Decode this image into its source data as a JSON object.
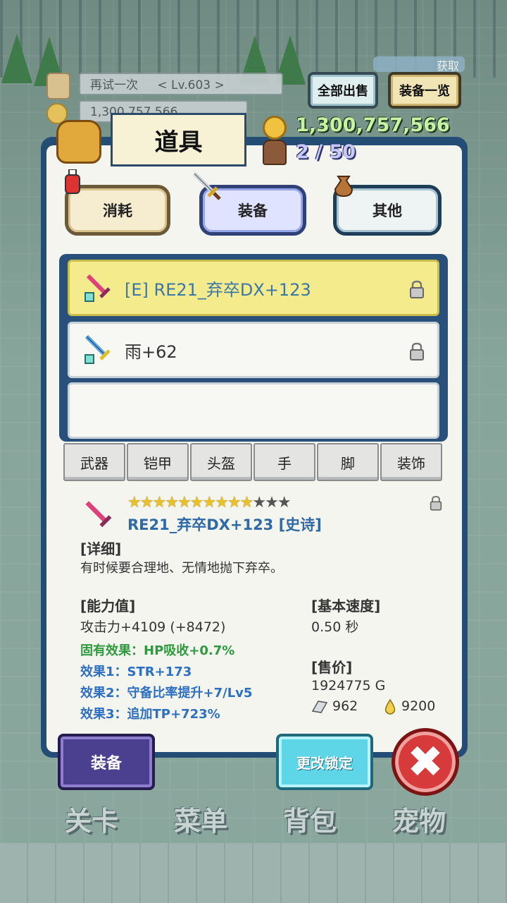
{
  "top": {
    "retry_label": "再试一次",
    "level": "< Lv.603 >",
    "gold_bg": "1,300,757,566",
    "sell_all_label": "全部出售",
    "equip_list_label": "装备一览",
    "gain_label": "获取"
  },
  "panel": {
    "title": "道具",
    "gold": "1,300,757,566",
    "capacity": "2 / 50"
  },
  "categories": {
    "consume": "消耗",
    "equip": "装备",
    "other": "其他"
  },
  "items": [
    {
      "label": "[E] RE21_弃卒DX+123",
      "locked": true
    },
    {
      "label": "雨+62",
      "locked": true
    },
    {
      "label": "",
      "locked": false
    }
  ],
  "slots": [
    "武器",
    "铠甲",
    "头盔",
    "手",
    "脚",
    "装饰"
  ],
  "detail": {
    "stars_filled": 10,
    "stars_total": 13,
    "name": "RE21_弃卒DX+123 [史诗]",
    "desc_head": "[详细]",
    "desc": "有时候要合理地、无情地抛下弃卒。",
    "stats_head": "[能力值]",
    "attack": "攻击力+4109 (+8472)",
    "inherent": "固有效果：HP吸收+0.7%",
    "effect1": "效果1：STR+173",
    "effect2": "效果2：守备比率提升+7/Lv5",
    "effect3": "效果3：追加TP+723%",
    "speed_head": "[基本速度]",
    "speed": "0.50 秒",
    "price_head": "[售价]",
    "price": "1924775 G",
    "ore": "962",
    "drop": "9200"
  },
  "buttons": {
    "equip": "装备",
    "change_lock": "更改锁定",
    "close": "✖"
  },
  "nav": [
    "关卡",
    "菜单",
    "背包",
    "宠物"
  ],
  "colors": {
    "panel_border": "#244d76",
    "selected_row": "#f4ec8c",
    "item_name": "#2f6aa6",
    "gold_text": "#c9f3a4"
  }
}
